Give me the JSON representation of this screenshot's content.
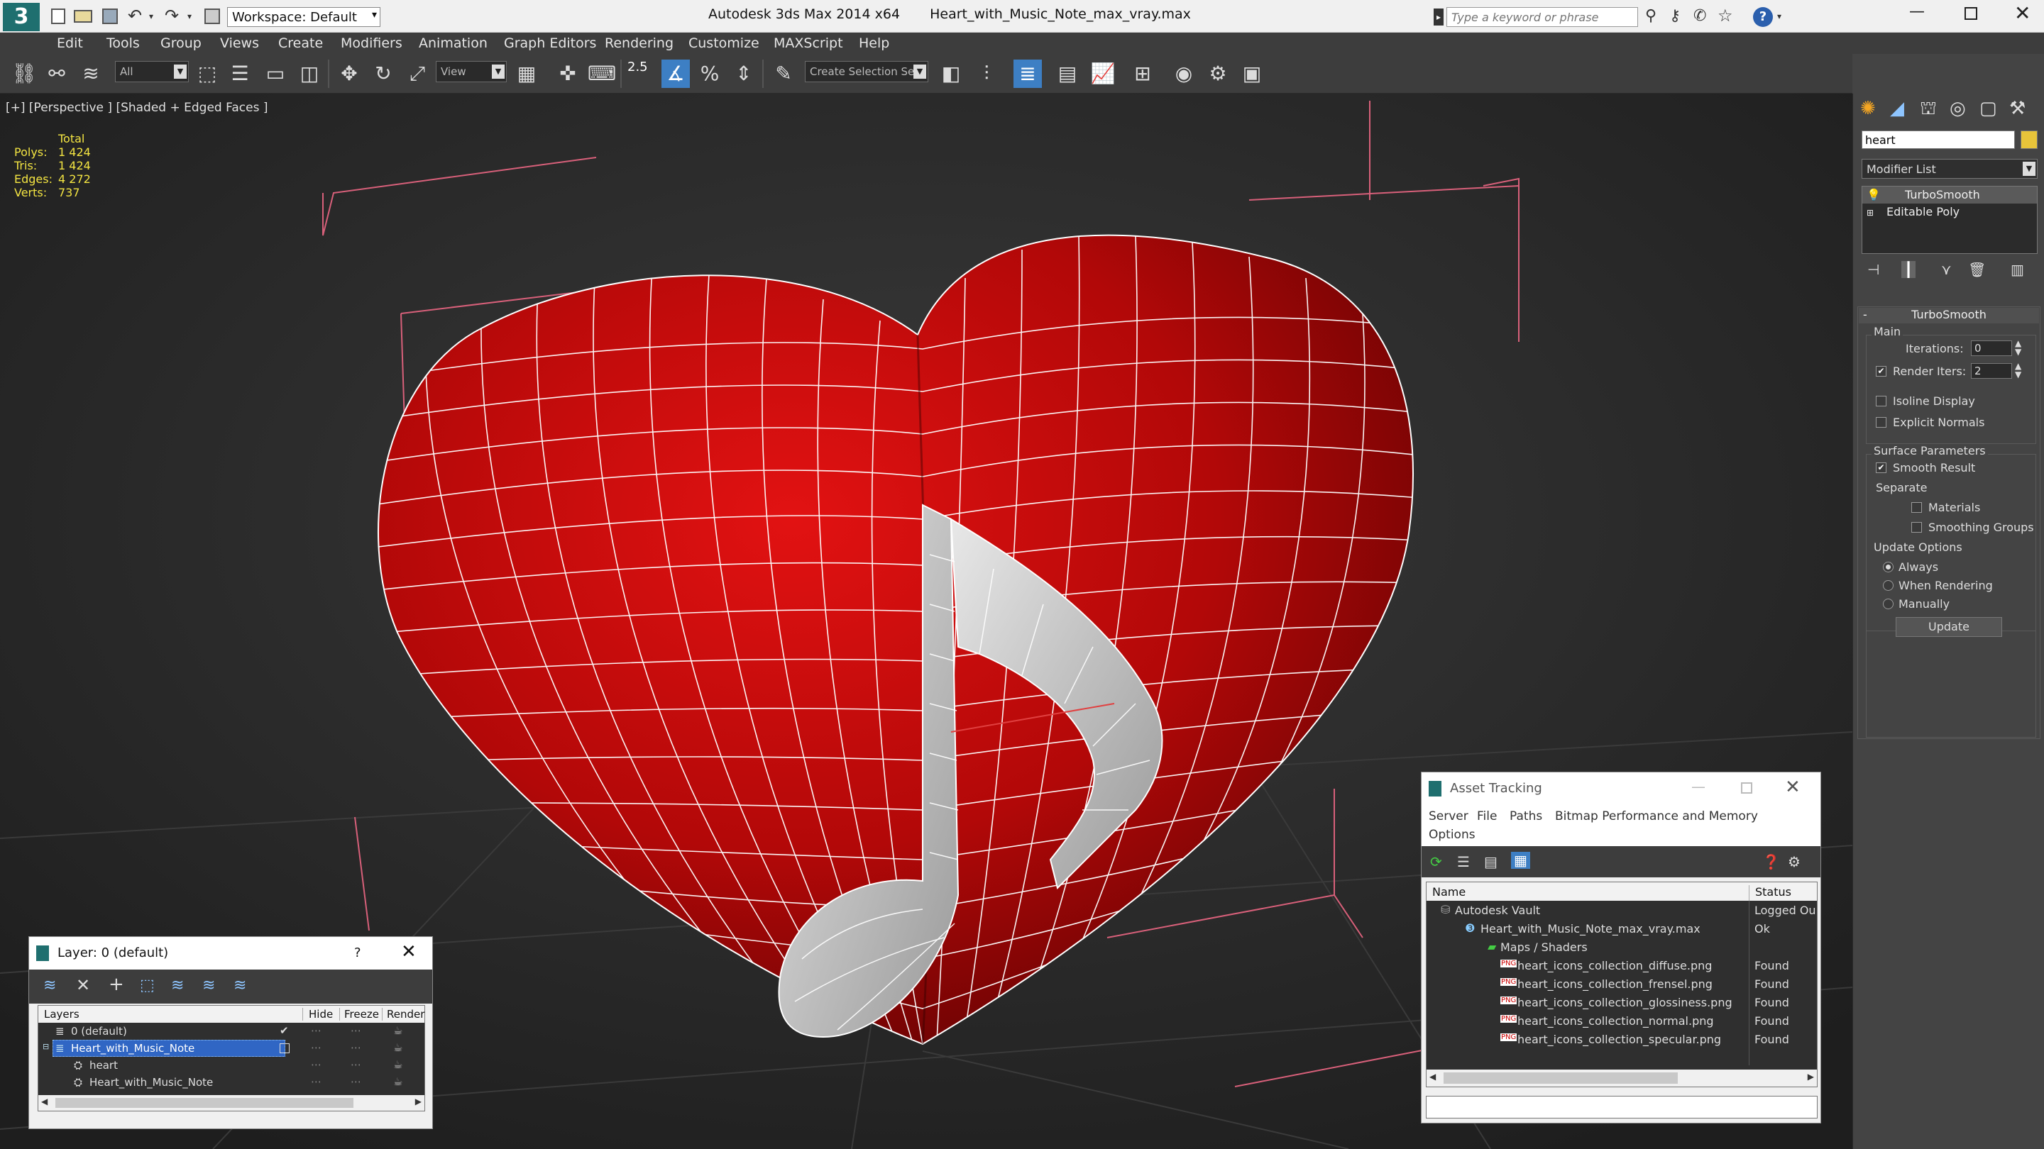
{
  "app": {
    "title": "Autodesk 3ds Max  2014 x64",
    "filename": "Heart_with_Music_Note_max_vray.max",
    "workspace": "Workspace: Default",
    "search_placeholder": "Type a keyword or phrase"
  },
  "menu": [
    "Edit",
    "Tools",
    "Group",
    "Views",
    "Create",
    "Modifiers",
    "Animation",
    "Graph Editors",
    "Rendering",
    "Customize",
    "MAXScript",
    "Help"
  ],
  "toolbar": {
    "selection_filter": "All",
    "view_label": "View",
    "snap_label": "2.5",
    "selection_set": "Create Selection Se"
  },
  "viewport": {
    "label": "[+] [Perspective ] [Shaded + Edged Faces ]",
    "stats_header": "Total",
    "stats": [
      {
        "label": "Polys:",
        "value": "1 424"
      },
      {
        "label": "Tris:",
        "value": "1 424"
      },
      {
        "label": "Edges:",
        "value": "4 272"
      },
      {
        "label": "Verts:",
        "value": "737"
      }
    ]
  },
  "command_panel": {
    "object_name": "heart",
    "modifier_list": "Modifier List",
    "stack": [
      "TurboSmooth",
      "Editable Poly"
    ],
    "rollout_title": "TurboSmooth",
    "main_label": "Main",
    "iterations_label": "Iterations:",
    "iterations_value": "0",
    "render_iters_label": "Render Iters:",
    "render_iters_value": "2",
    "isoline_label": "Isoline Display",
    "explicit_normals_label": "Explicit Normals",
    "surface_params_label": "Surface Parameters",
    "smooth_result_label": "Smooth Result",
    "separate_label": "Separate",
    "materials_label": "Materials",
    "smoothing_groups_label": "Smoothing Groups",
    "update_options_label": "Update Options",
    "always_label": "Always",
    "when_rendering_label": "When Rendering",
    "manually_label": "Manually",
    "update_button": "Update"
  },
  "layer_panel": {
    "title": "Layer: 0 (default)",
    "help": "?",
    "columns": [
      "Layers",
      "Hide",
      "Freeze",
      "Render"
    ],
    "rows": [
      {
        "name": "0 (default)",
        "indent": 0,
        "selected": false
      },
      {
        "name": "Heart_with_Music_Note",
        "indent": 0,
        "selected": true
      },
      {
        "name": "heart",
        "indent": 1,
        "selected": false
      },
      {
        "name": "Heart_with_Music_Note",
        "indent": 1,
        "selected": false
      }
    ]
  },
  "asset_panel": {
    "title": "Asset Tracking",
    "menu": [
      "Server",
      "File",
      "Paths",
      "Bitmap Performance and Memory"
    ],
    "menu2": "Options",
    "columns": [
      "Name",
      "Status"
    ],
    "rows": [
      {
        "name": "Autodesk Vault",
        "status": "Logged Ou",
        "indent": 0
      },
      {
        "name": "Heart_with_Music_Note_max_vray.max",
        "status": "Ok",
        "indent": 1
      },
      {
        "name": "Maps / Shaders",
        "status": "",
        "indent": 2
      },
      {
        "name": "heart_icons_collection_diffuse.png",
        "status": "Found",
        "indent": 3
      },
      {
        "name": "heart_icons_collection_frensel.png",
        "status": "Found",
        "indent": 3
      },
      {
        "name": "heart_icons_collection_glossiness.png",
        "status": "Found",
        "indent": 3
      },
      {
        "name": "heart_icons_collection_normal.png",
        "status": "Found",
        "indent": 3
      },
      {
        "name": "heart_icons_collection_specular.png",
        "status": "Found",
        "indent": 3
      }
    ]
  }
}
